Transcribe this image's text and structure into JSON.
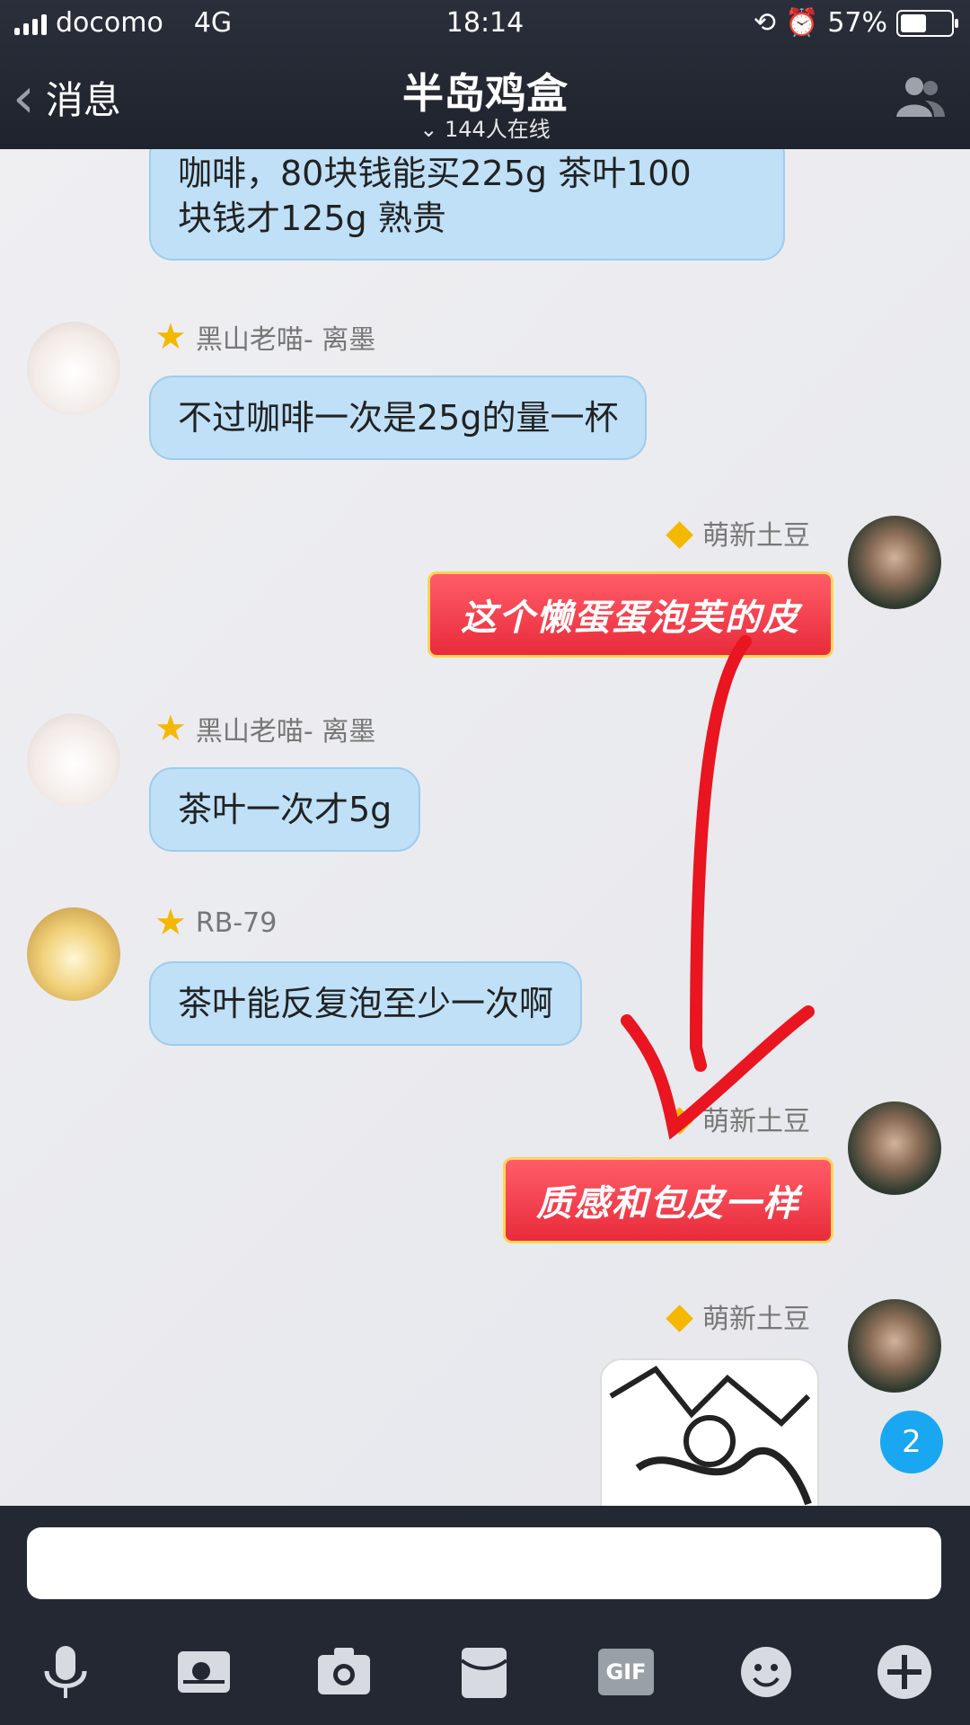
{
  "status_bar": {
    "carrier": "docomo",
    "network": "4G",
    "time": "18:14",
    "battery": "57%",
    "battery_level": 0.57
  },
  "header": {
    "back_label": "消息",
    "title": "半岛鸡盒",
    "online": "144人在线"
  },
  "messages": [
    {
      "sender": "",
      "text_line1": "咖啡，80块钱能买225g 茶叶100",
      "text_line2": "块钱才125g 熟贵"
    },
    {
      "sender": "黑山老喵- 离墨",
      "text": "不过咖啡一次是25g的量一杯"
    },
    {
      "sender": "萌新土豆",
      "text": "这个懒蛋蛋泡芙的皮"
    },
    {
      "sender": "黑山老喵- 离墨",
      "text": "茶叶一次才5g"
    },
    {
      "sender": "RB-79",
      "text": "茶叶能反复泡至少一次啊"
    },
    {
      "sender": "萌新土豆",
      "text": "质感和包皮一样"
    },
    {
      "sender": "萌新土豆",
      "text": ""
    }
  ],
  "unread_badge": "2",
  "toolbar": {
    "gif_label": "GIF"
  },
  "icons": [
    "back-chevron-icon",
    "group-members-icon",
    "microphone-icon",
    "photo-icon",
    "camera-icon",
    "red-packet-icon",
    "gif-icon",
    "emoji-icon",
    "plus-icon",
    "star-icon"
  ]
}
